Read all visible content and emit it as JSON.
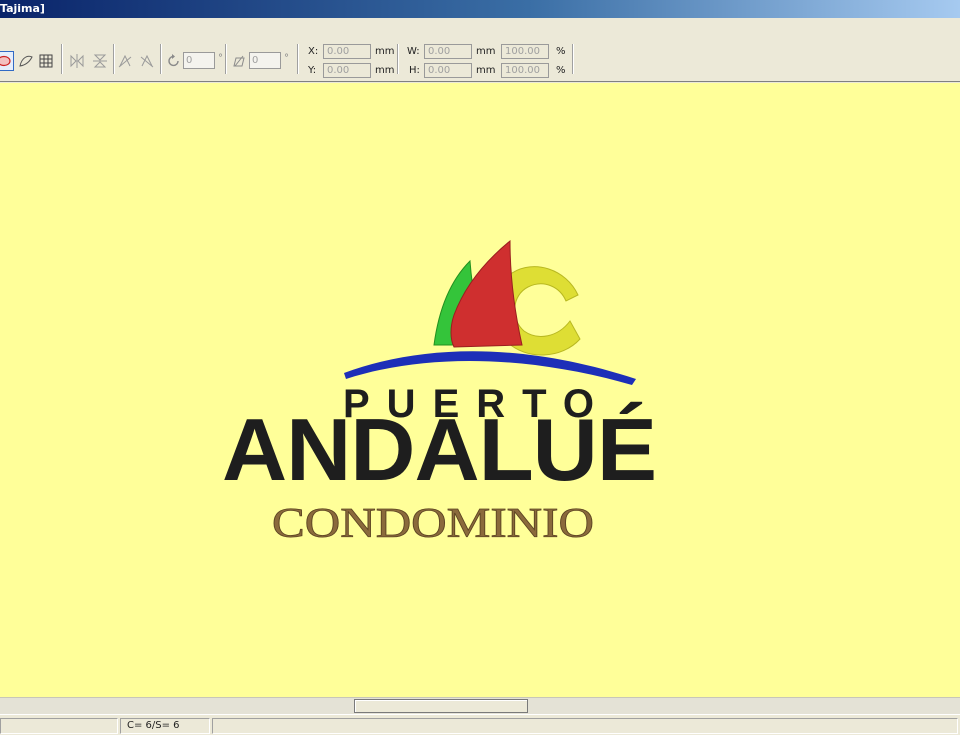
{
  "window": {
    "title": "Tajima]"
  },
  "toolbar": {
    "rotate_value": "0",
    "rotate_unit": "°",
    "slant_value": "0",
    "slant_unit": "°",
    "x_label": "X:",
    "y_label": "Y:",
    "w_label": "W:",
    "h_label": "H:",
    "x_value": "0.00",
    "y_value": "0.00",
    "w_value": "0.00",
    "h_value": "0.00",
    "w_percent": "100.00",
    "h_percent": "100.00",
    "unit_mm": "mm",
    "unit_pct": "%"
  },
  "design": {
    "line1": "PUERTO",
    "line2": "ANDALUÉ",
    "line3": "CONDOMINIO",
    "colors": {
      "background": "#ffff99",
      "dark_text": "#1e1e1e",
      "brown_text": "#8a6a3c",
      "wave": "#1d2fb8",
      "sail_red": "#cf2f2f",
      "sail_green": "#34c43a",
      "ring_yellow": "#dede34"
    }
  },
  "status": {
    "text": "C= 6/S= 6"
  },
  "icons": [
    "ellipse-tool-icon",
    "freehand-tool-icon",
    "grid-icon",
    "mirror-horizontal-icon",
    "mirror-vertical-icon",
    "align-left-icon",
    "align-right-icon",
    "rotate-icon",
    "slant-icon"
  ]
}
